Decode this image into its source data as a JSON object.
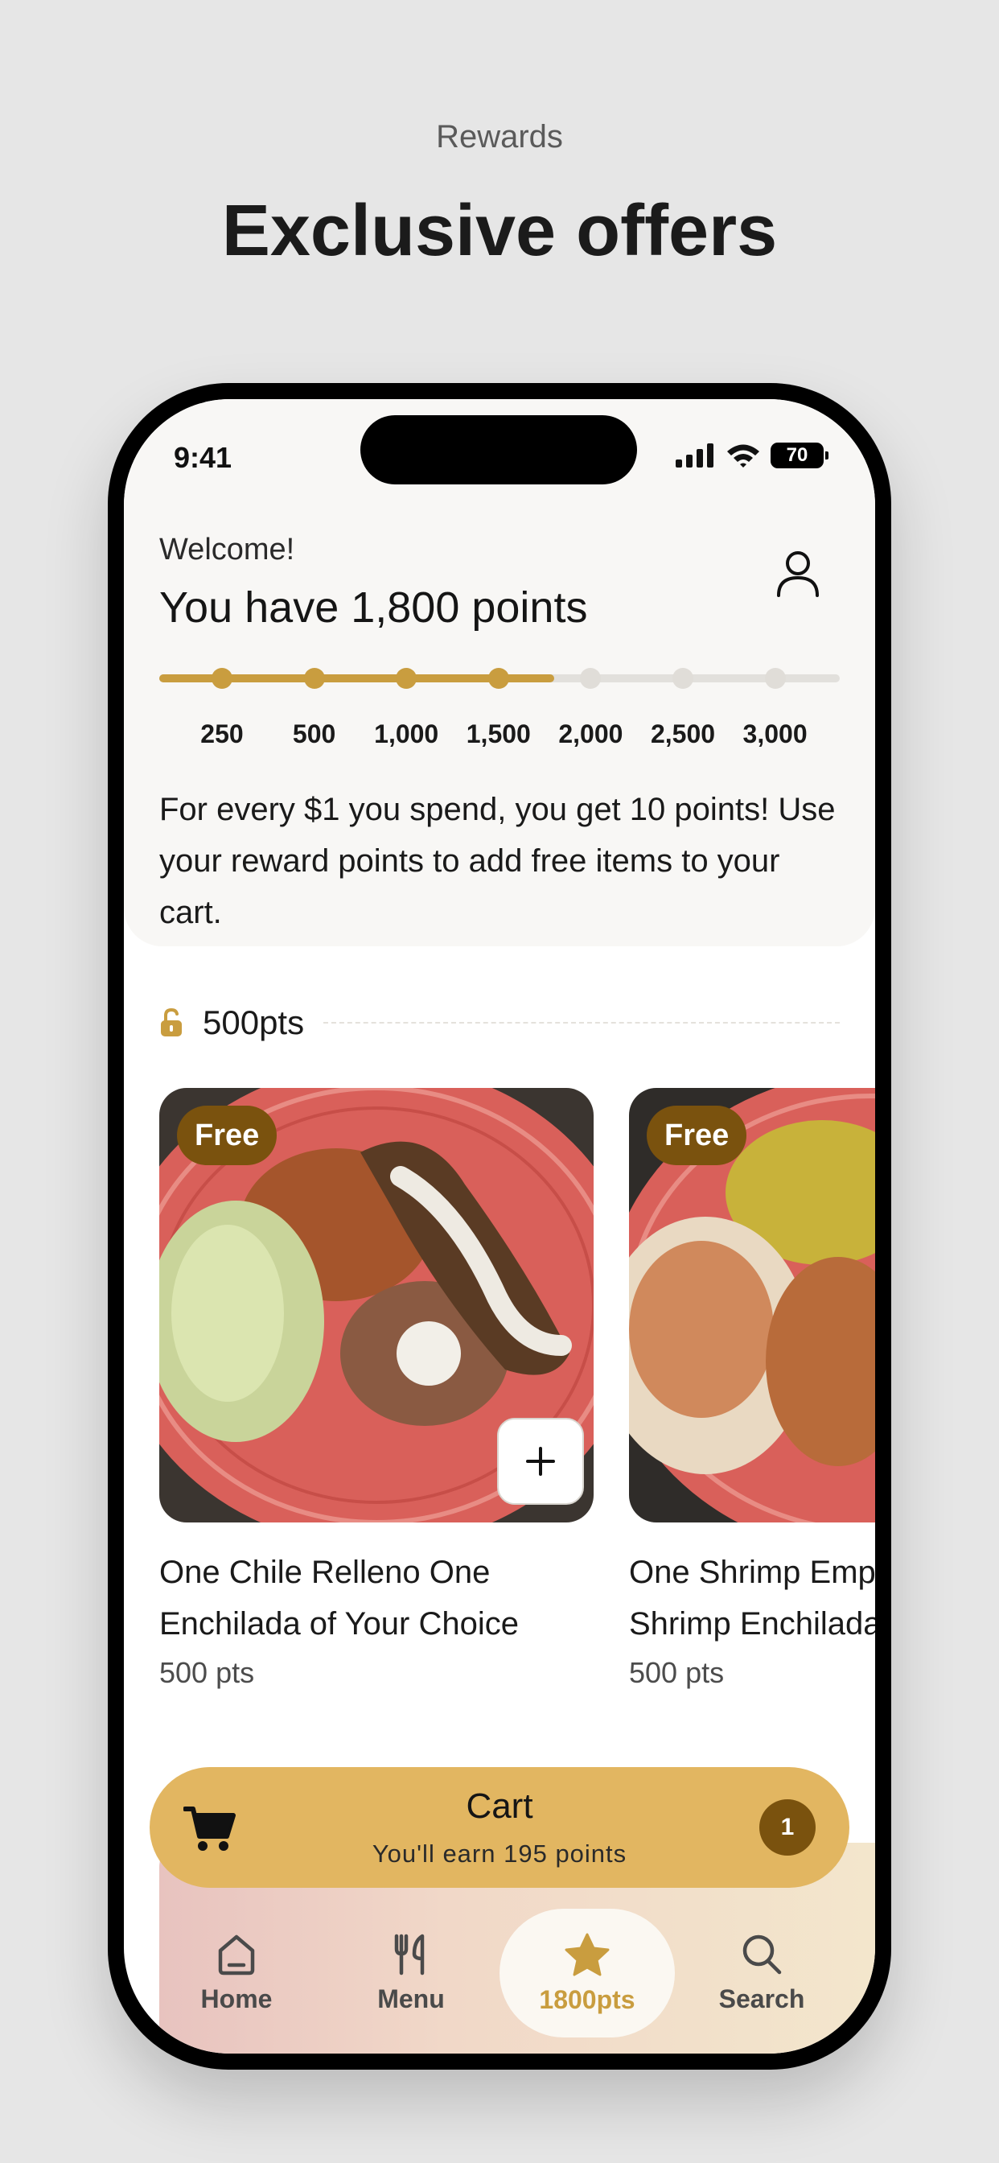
{
  "page": {
    "kicker": "Rewards",
    "headline": "Exclusive offers"
  },
  "status_bar": {
    "time": "9:41",
    "battery": "70"
  },
  "header": {
    "welcome": "Welcome!",
    "points_title": "You have 1,800 points",
    "profile_icon": "person-icon"
  },
  "progress": {
    "current_points": 1800,
    "max_points": 3000,
    "tiers": [
      {
        "label": "250",
        "value": 250
      },
      {
        "label": "500",
        "value": 500
      },
      {
        "label": "1,000",
        "value": 1000
      },
      {
        "label": "1,500",
        "value": 1500
      },
      {
        "label": "2,000",
        "value": 2000
      },
      {
        "label": "2,500",
        "value": 2500
      },
      {
        "label": "3,000",
        "value": 3000
      }
    ],
    "fill_color": "#c99d3f",
    "track_color": "#e2e0dc"
  },
  "promo_text": "For every $1 you spend, you get 10 points! Use your reward points to add free items to your cart.",
  "reward_section": {
    "label": "500pts",
    "icon": "unlock-icon",
    "items": [
      {
        "badge": "Free",
        "name_line1": "One Chile Relleno One",
        "name_line2": "Enchilada of Your Choice",
        "points": "500 pts"
      },
      {
        "badge": "Free",
        "name_line1": "One Shrimp Empanada One",
        "name_line2": "Shrimp Enchilada",
        "points": "500 pts"
      }
    ]
  },
  "cart": {
    "title": "Cart",
    "subtitle": "You'll earn 195 points",
    "count": "1",
    "icon": "cart-icon"
  },
  "tabs": [
    {
      "label": "Home",
      "icon": "home-icon",
      "active": false
    },
    {
      "label": "Menu",
      "icon": "fork-knife-icon",
      "active": false
    },
    {
      "label": "1800pts",
      "icon": "star-icon",
      "active": true
    },
    {
      "label": "Search",
      "icon": "search-icon",
      "active": false
    }
  ],
  "colors": {
    "accent": "#c99d3f",
    "cart_bar": "#e2b661",
    "badge": "#7a520e",
    "background": "#e6e6e6"
  }
}
